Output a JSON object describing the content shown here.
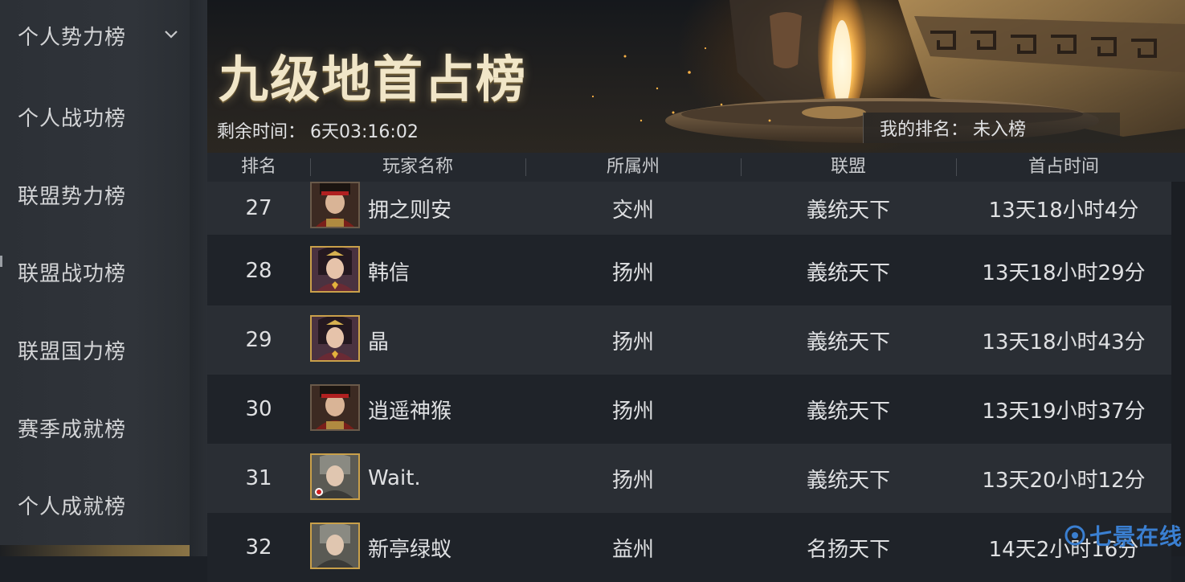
{
  "sidebar": {
    "items": [
      {
        "label": "个人势力榜",
        "expanded": true
      },
      {
        "label": "个人战功榜"
      },
      {
        "label": "联盟势力榜"
      },
      {
        "label": "联盟战功榜"
      },
      {
        "label": "联盟国力榜"
      },
      {
        "label": "赛季成就榜"
      },
      {
        "label": "个人成就榜"
      }
    ]
  },
  "banner": {
    "title": "九级地首占榜",
    "countdown_label": "剩余时间：",
    "countdown_value": "6天03:16:02",
    "my_rank_label": "我的排名：",
    "my_rank_value": "未入榜"
  },
  "table": {
    "headers": [
      "排名",
      "玩家名称",
      "所属州",
      "联盟",
      "首占时间"
    ],
    "rows": [
      {
        "rank": "27",
        "name": "拥之则安",
        "state": "交州",
        "alliance": "義统天下",
        "time": "13天18小时4分",
        "avatar": "male-warrior"
      },
      {
        "rank": "28",
        "name": "韩信",
        "state": "扬州",
        "alliance": "義统天下",
        "time": "13天18小时29分",
        "avatar": "female-general"
      },
      {
        "rank": "29",
        "name": "晶",
        "state": "扬州",
        "alliance": "義统天下",
        "time": "13天18小时43分",
        "avatar": "female-general"
      },
      {
        "rank": "30",
        "name": "逍遥神猴",
        "state": "扬州",
        "alliance": "義统天下",
        "time": "13天19小时37分",
        "avatar": "male-warrior"
      },
      {
        "rank": "31",
        "name": "Wait.",
        "state": "扬州",
        "alliance": "義统天下",
        "time": "13天20小时12分",
        "avatar": "male-scholar"
      },
      {
        "rank": "32",
        "name": "新亭绿蚁",
        "state": "益州",
        "alliance": "名扬天下",
        "time": "14天2小时16分",
        "avatar": "male-scholar"
      }
    ]
  },
  "watermark": "七景在线",
  "colors": {
    "accent_gold": "#c9a04a",
    "text": "#dfe0e2",
    "watermark": "#3a7fd1"
  }
}
